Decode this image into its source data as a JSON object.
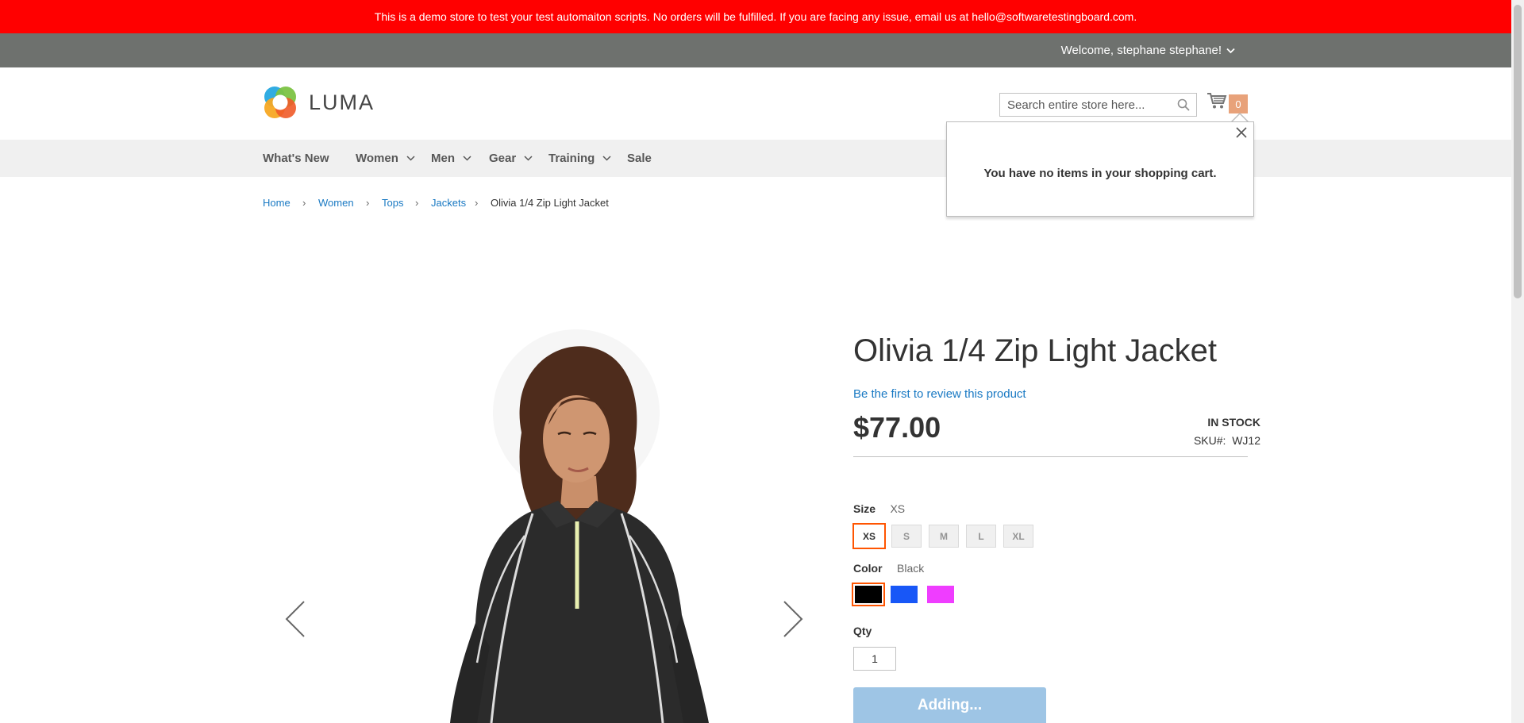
{
  "notice": {
    "text": "This is a demo store to test your test automaiton scripts. No orders will be fulfilled. If you are facing any issue, email us at hello@softwaretestingboard.com."
  },
  "header": {
    "welcome": "Welcome, stephane stephane!"
  },
  "logo": {
    "text": "LUMA"
  },
  "search": {
    "placeholder": "Search entire store here..."
  },
  "cart": {
    "count": "0"
  },
  "minicart": {
    "message": "You have no items in your shopping cart."
  },
  "nav": {
    "items": [
      {
        "label": "What's New"
      },
      {
        "label": "Women"
      },
      {
        "label": "Men"
      },
      {
        "label": "Gear"
      },
      {
        "label": "Training"
      },
      {
        "label": "Sale"
      }
    ]
  },
  "breadcrumb": {
    "items": [
      {
        "label": "Home"
      },
      {
        "label": "Women"
      },
      {
        "label": "Tops"
      },
      {
        "label": "Jackets"
      },
      {
        "label": "Olivia 1/4 Zip Light Jacket"
      }
    ]
  },
  "product": {
    "title": "Olivia 1/4 Zip Light Jacket",
    "review_link": "Be the first to review this product",
    "price": "$77.00",
    "stock": "In stock",
    "sku_label": "SKU#:",
    "sku": "WJ12",
    "size_label": "Size",
    "size_selected": "XS",
    "sizes": [
      "XS",
      "S",
      "M",
      "L",
      "XL"
    ],
    "color_label": "Color",
    "color_selected": "Black",
    "colors": [
      {
        "name": "Black",
        "hex": "#000000"
      },
      {
        "name": "Blue",
        "hex": "#1857f7"
      },
      {
        "name": "Purple",
        "hex": "#ef3dff"
      }
    ],
    "qty_label": "Qty",
    "qty": "1",
    "add_button": "Adding..."
  },
  "colors": {
    "notice_bg": "#ff0000",
    "panel_bg": "#6e716e",
    "link": "#1979c3",
    "selected_outline": "#ff5501",
    "button_bg": "#9ec5e5"
  }
}
